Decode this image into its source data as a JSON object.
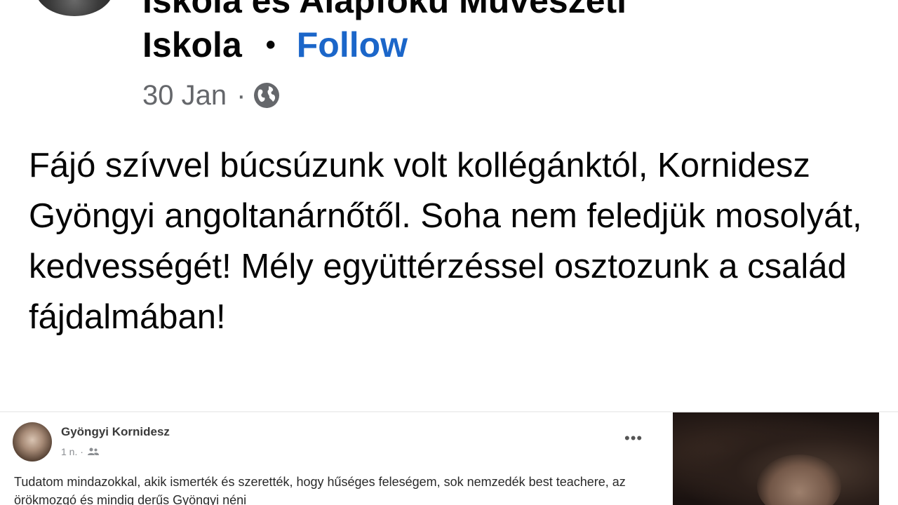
{
  "header": {
    "page_name_line1": "Iskola és Alapfokú Művészeti",
    "page_name_line2": "Iskola",
    "separator": "•",
    "follow_label": "Follow",
    "date": "30 Jan",
    "meta_separator": "·",
    "privacy_icon": "globe-icon",
    "follow_color": "#1b66c9"
  },
  "post": {
    "text": "Fájó szívvel búcsúzunk volt kollégánktól, Kornidesz Gyöngyi angoltanárnőtől. Soha nem feledjük mosolyát, kedvességét! Mély együttérzéssel osztozunk a család fájdalmában!"
  },
  "shared_post": {
    "author": "Gyöngyi Kornidesz",
    "time": "1 n. ·",
    "audience_icon": "friends-icon",
    "more_label": "•••",
    "text": "Tudatom mindazokkal, akik ismerték és szerették, hogy hűséges feleségem, sok nemzedék best teachere, az örökmozgó és mindig derűs Gyöngyi néni"
  }
}
